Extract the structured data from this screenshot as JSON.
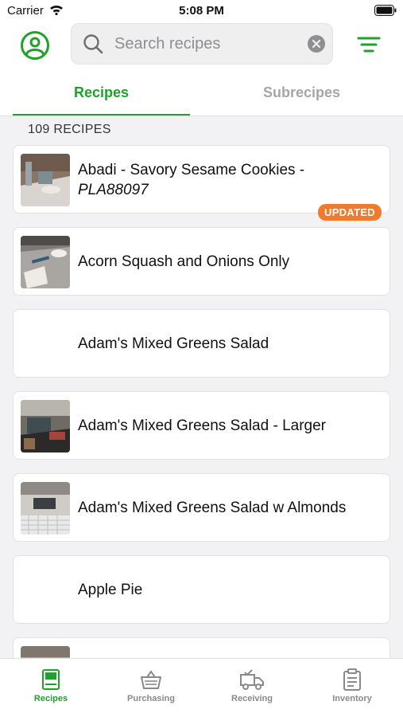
{
  "status_bar": {
    "carrier": "Carrier",
    "time": "5:08 PM"
  },
  "search": {
    "placeholder": "Search recipes",
    "value": ""
  },
  "tabs": {
    "recipes": "Recipes",
    "subrecipes": "Subrecipes"
  },
  "recipe_count": "109 RECIPES",
  "recipes": [
    {
      "name": "Abadi - Savory Sesame Cookies  -",
      "code": "PLA88097",
      "badge": "UPDATED",
      "has_photo": true
    },
    {
      "name": "Acorn Squash and Onions Only",
      "has_photo": true
    },
    {
      "name": "Adam's Mixed Greens Salad",
      "has_photo": false
    },
    {
      "name": "Adam's Mixed Greens Salad - Larger",
      "has_photo": true
    },
    {
      "name": "Adam's Mixed Greens Salad w Almonds",
      "has_photo": true
    },
    {
      "name": "Apple Pie",
      "has_photo": false
    }
  ],
  "bottom_nav": [
    {
      "label": "Recipes",
      "icon": "recipe-book-icon",
      "active": true
    },
    {
      "label": "Purchasing",
      "icon": "basket-icon",
      "active": false
    },
    {
      "label": "Receiving",
      "icon": "truck-icon",
      "active": false
    },
    {
      "label": "Inventory",
      "icon": "clipboard-icon",
      "active": false
    }
  ],
  "colors": {
    "accent": "#1fa12a",
    "badge": "#f07b2c",
    "inactive": "#8a8a8a"
  }
}
